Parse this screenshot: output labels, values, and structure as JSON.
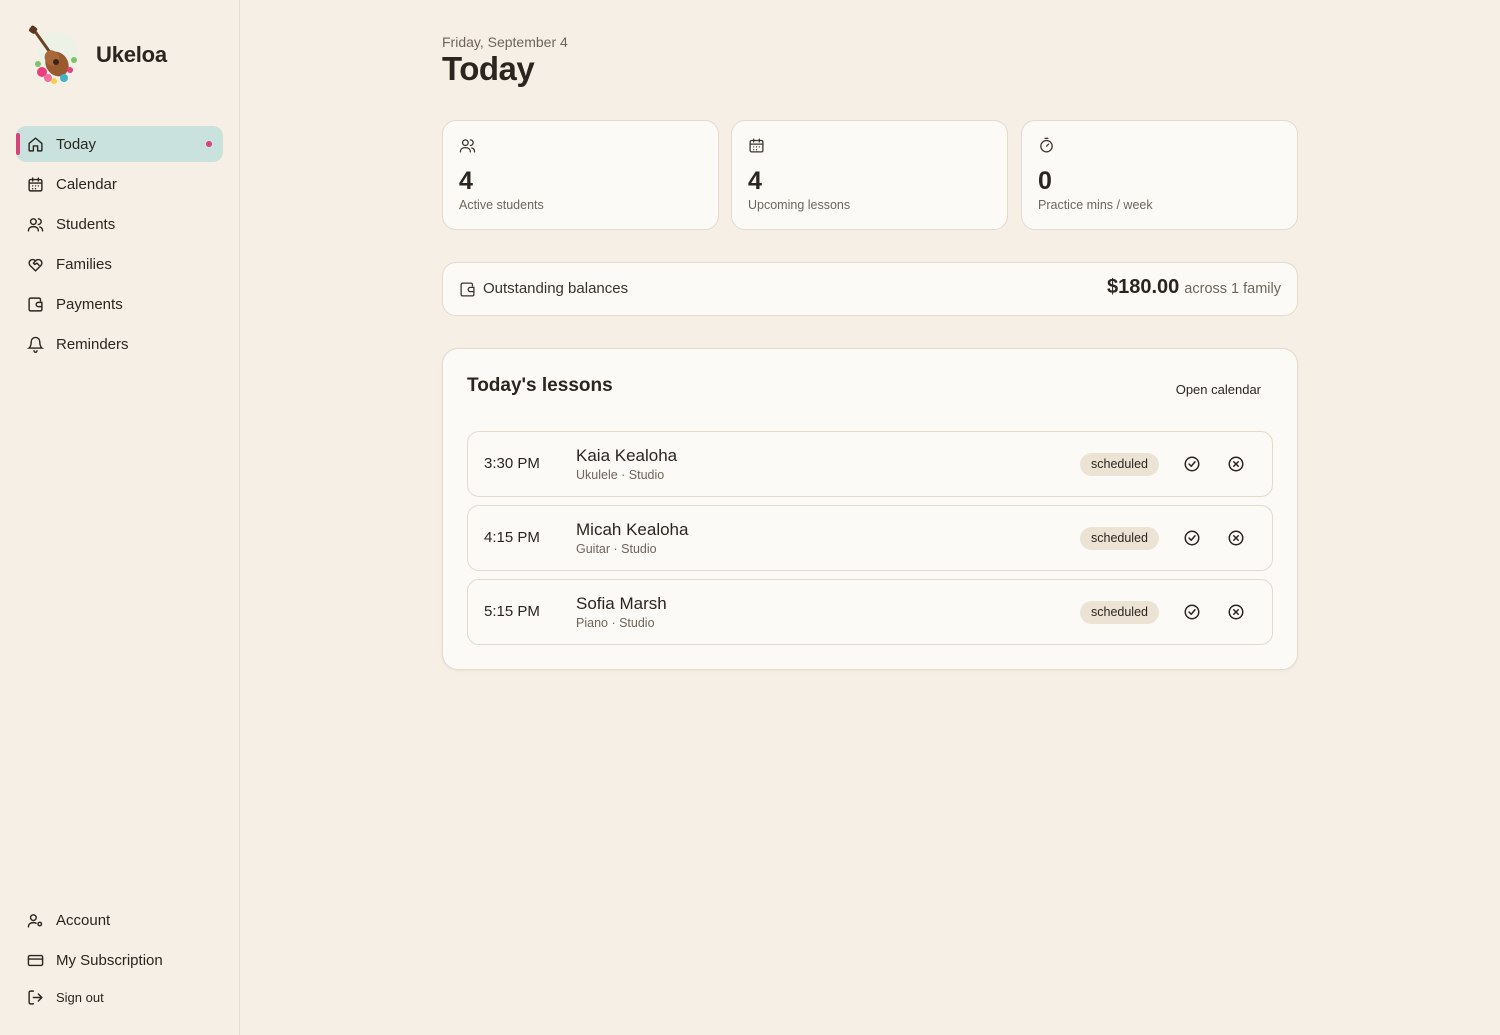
{
  "brand": {
    "name": "Ukeloa",
    "logo_icon": "ukulele-flower-logo"
  },
  "nav": {
    "items": [
      {
        "label": "Today",
        "icon": "home-icon",
        "active": true
      },
      {
        "label": "Calendar",
        "icon": "calendar-icon"
      },
      {
        "label": "Students",
        "icon": "users-icon"
      },
      {
        "label": "Families",
        "icon": "heart-handshake-icon"
      },
      {
        "label": "Payments",
        "icon": "wallet-icon"
      },
      {
        "label": "Reminders",
        "icon": "bell-icon"
      }
    ],
    "bottom": [
      {
        "label": "Account",
        "icon": "user-cog-icon"
      },
      {
        "label": "My Subscription",
        "icon": "credit-card-icon"
      },
      {
        "label": "Sign out",
        "icon": "sign-out-icon"
      }
    ]
  },
  "header": {
    "date": "Friday, September 4",
    "title": "Today"
  },
  "stats": [
    {
      "value": "4",
      "label": "Active students",
      "icon": "users-icon"
    },
    {
      "value": "4",
      "label": "Upcoming lessons",
      "icon": "calendar-icon"
    },
    {
      "value": "0",
      "label": "Practice mins / week",
      "icon": "timer-icon"
    }
  ],
  "balances": {
    "label": "Outstanding balances",
    "amount": "$180.00",
    "sub": "across 1 family",
    "icon": "wallet-icon"
  },
  "lessons": {
    "title": "Today's lessons",
    "open_calendar": "Open calendar",
    "rows": [
      {
        "time": "3:30 PM",
        "name": "Kaia Kealoha",
        "detail": "Ukulele · Studio",
        "status": "scheduled"
      },
      {
        "time": "4:15 PM",
        "name": "Micah Kealoha",
        "detail": "Guitar · Studio",
        "status": "scheduled"
      },
      {
        "time": "5:15 PM",
        "name": "Sofia Marsh",
        "detail": "Piano · Studio",
        "status": "scheduled"
      }
    ]
  },
  "colors": {
    "accent": "#d6427a",
    "active_bg": "#c9e2dd",
    "background": "#f6efe6",
    "card": "#fcfaf6"
  }
}
